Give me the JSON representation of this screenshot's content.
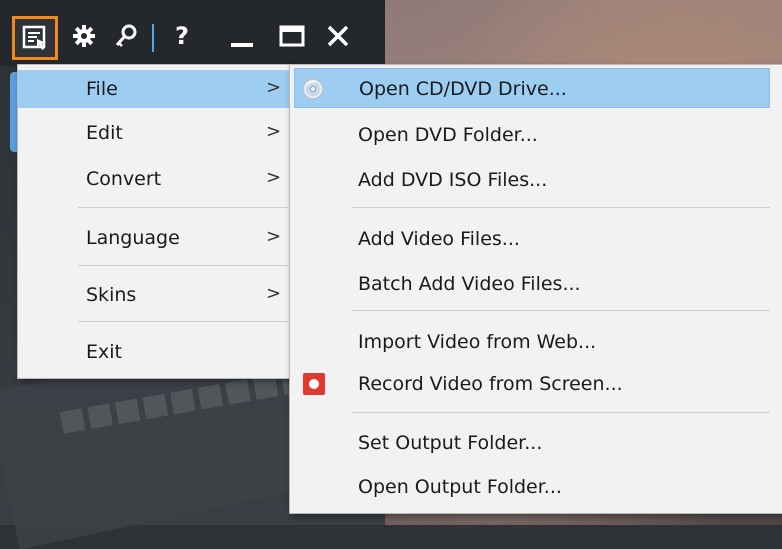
{
  "toolbar": {
    "icons": [
      "menu-icon",
      "gear-icon",
      "key-icon",
      "help-icon",
      "minimize-icon",
      "maximize-icon",
      "close-icon"
    ],
    "help_label": "?",
    "accent_color": "#f08a1c"
  },
  "menu": {
    "items": [
      {
        "label": "File",
        "arrow": ">",
        "highlighted": true
      },
      {
        "label": "Edit",
        "arrow": ">"
      },
      {
        "label": "Convert",
        "arrow": ">"
      },
      {
        "label": "Language",
        "arrow": ">"
      },
      {
        "label": "Skins",
        "arrow": ">"
      },
      {
        "label": "Exit"
      }
    ]
  },
  "submenu": {
    "items": [
      {
        "label": "Open CD/DVD Drive...",
        "icon": "disc-icon",
        "highlighted": true
      },
      {
        "label": "Open DVD Folder..."
      },
      {
        "label": "Add DVD ISO Files..."
      },
      {
        "label": "Add Video Files..."
      },
      {
        "label": "Batch Add Video Files..."
      },
      {
        "label": "Import Video from Web..."
      },
      {
        "label": "Record Video from Screen...",
        "icon": "record-icon"
      },
      {
        "label": "Set Output Folder..."
      },
      {
        "label": "Open Output Folder..."
      }
    ]
  },
  "colors": {
    "highlight": "#9ecdf2",
    "menu_bg": "#f2f2f2",
    "record_red": "#e03a2f"
  }
}
